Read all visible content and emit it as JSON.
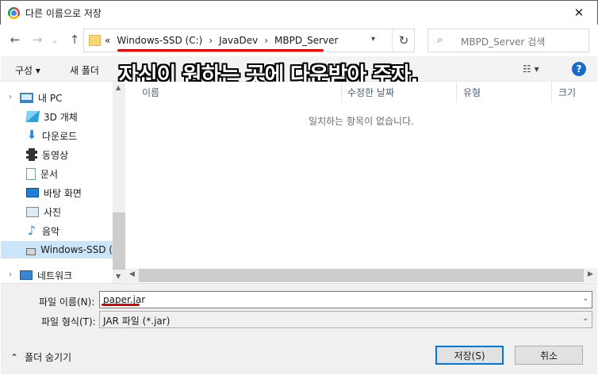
{
  "window": {
    "title": "다른 이름으로 저장",
    "close_glyph": "✕"
  },
  "nav": {
    "back_glyph": "←",
    "forward_glyph": "→",
    "recent_glyph": "⌄",
    "up_glyph": "↑",
    "breadcrumbs": [
      "«",
      "Windows-SSD (C:)",
      "›",
      "JavaDev",
      "›",
      "MBPD_Server"
    ],
    "refresh_glyph": "↻",
    "search_placeholder": "MBPD_Server 검색"
  },
  "toolbar": {
    "organize": "구성 ▾",
    "new_folder": "새 폴더",
    "view": "☷ ▾",
    "help": "?"
  },
  "caption": "자신이 원하는 곳에 다운받아 주자.",
  "sidebar": {
    "items": [
      {
        "label": "내 PC",
        "icon": "pc-icon"
      },
      {
        "label": "3D 개체",
        "icon": "3d-objects-icon"
      },
      {
        "label": "다운로드",
        "icon": "downloads-icon"
      },
      {
        "label": "동영상",
        "icon": "videos-icon"
      },
      {
        "label": "문서",
        "icon": "documents-icon"
      },
      {
        "label": "바탕 화면",
        "icon": "desktop-icon"
      },
      {
        "label": "사진",
        "icon": "pictures-icon"
      },
      {
        "label": "음악",
        "icon": "music-icon"
      },
      {
        "label": "Windows-SSD (",
        "icon": "drive-icon"
      },
      {
        "label": "네트워크",
        "icon": "network-icon"
      }
    ]
  },
  "columns": [
    "이름",
    "수정한 날짜",
    "유형",
    "크기"
  ],
  "empty_message": "일치하는 항목이 없습니다.",
  "form": {
    "filename_label": "파일 이름(N):",
    "filename_value": "paper.jar",
    "filetype_label": "파일 형식(T):",
    "filetype_value": "JAR 파일 (*.jar)",
    "hide_folders": "폴더 숨기기",
    "save": "저장(S)",
    "cancel": "취소"
  }
}
